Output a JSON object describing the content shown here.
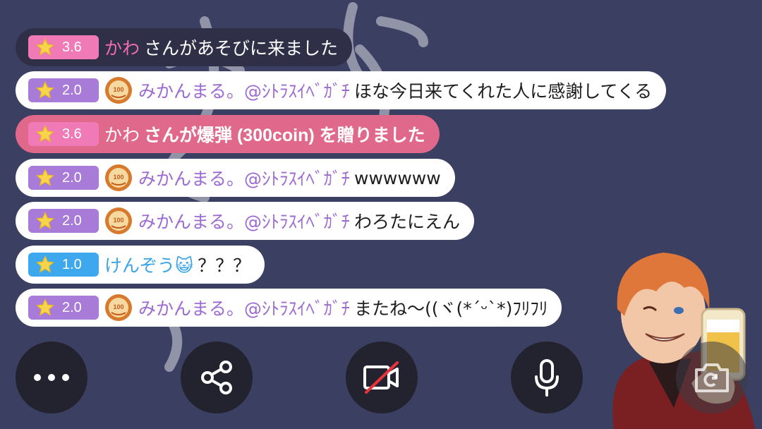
{
  "messages": [
    {
      "variant": "dark",
      "badge_color": "pink",
      "level": "3.6",
      "name": "かわ",
      "name_color": "pink",
      "text": "さんがあそびに来ました",
      "text_color": "white"
    },
    {
      "variant": "white",
      "badge_color": "purple",
      "level": "2.0",
      "coin": true,
      "name": "みかんまる。@ｼﾄﾗｽｲﾍﾞｶﾞﾁ",
      "name_color": "purple",
      "text": "ほな今日来てくれた人に感謝してくる",
      "text_color": "dark"
    },
    {
      "variant": "pink",
      "badge_color": "pink",
      "level": "3.6",
      "name": "かわ",
      "name_color": "white",
      "text": "さんが爆弾 (300coin) を贈りました",
      "text_color": "white"
    },
    {
      "variant": "white",
      "badge_color": "purple",
      "level": "2.0",
      "coin": true,
      "name": "みかんまる。@ｼﾄﾗｽｲﾍﾞｶﾞﾁ",
      "name_color": "purple",
      "text": "wwwwww",
      "text_color": "dark"
    },
    {
      "variant": "white",
      "badge_color": "purple",
      "level": "2.0",
      "coin": true,
      "name": "みかんまる。@ｼﾄﾗｽｲﾍﾞｶﾞﾁ",
      "name_color": "purple",
      "text": "わろたにえん",
      "text_color": "dark"
    },
    {
      "variant": "white",
      "badge_color": "blue",
      "level": "1.0",
      "name": "けんぞう😺",
      "name_color": "blue",
      "text": "？？？",
      "text_color": "dark"
    },
    {
      "variant": "white",
      "badge_color": "purple",
      "level": "2.0",
      "coin": true,
      "name": "みかんまる。@ｼﾄﾗｽｲﾍﾞｶﾞﾁ",
      "name_color": "purple",
      "text": "またね〜((ヾ(*´ᵕ`*)ﾌﾘﾌﾘ",
      "text_color": "dark"
    }
  ],
  "coin_label": "100",
  "controls": [
    {
      "icon": "more-icon"
    },
    {
      "icon": "share-icon"
    },
    {
      "icon": "camera-off-icon"
    },
    {
      "icon": "microphone-icon"
    },
    {
      "icon": "screenshot-camera-icon"
    }
  ],
  "colors": {
    "background": "#3b3f62",
    "purple": "#a97bd8",
    "pink": "#e0698b",
    "blue": "#3ea8ef",
    "button": "#23232f"
  }
}
